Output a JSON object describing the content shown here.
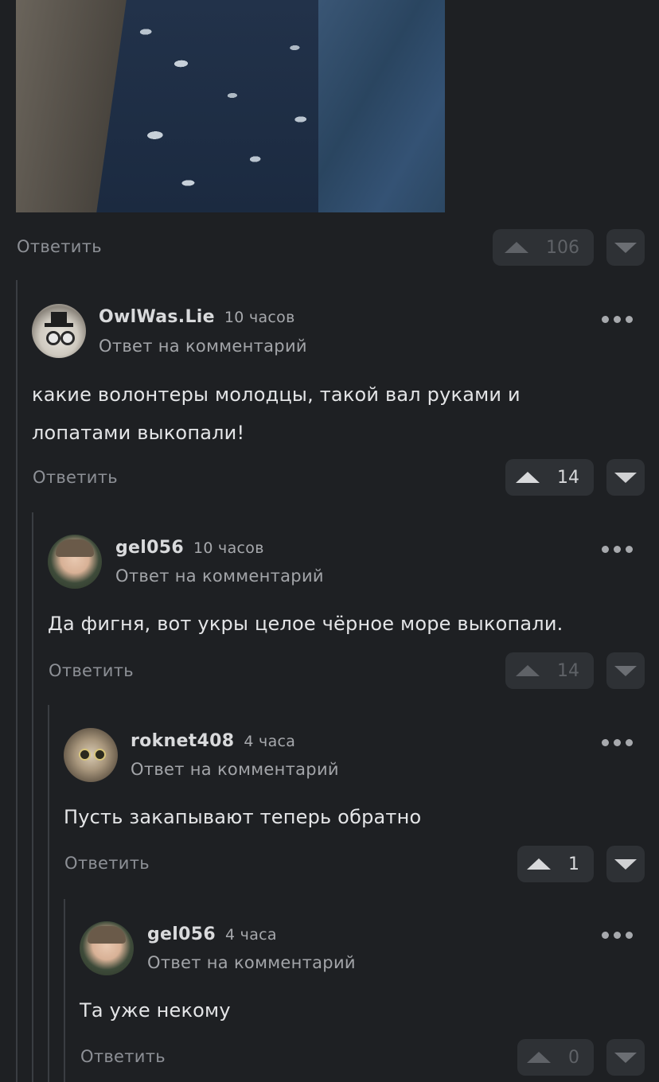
{
  "top": {
    "reply_label": "Ответить",
    "votes": "106"
  },
  "comments": [
    {
      "username": "OwlWas.Lie",
      "time": "10 часов",
      "subtitle": "Ответ на комментарий",
      "text_line1": "какие волонтеры молодцы, такой вал руками и",
      "text_line2": "лопатами выкопали!",
      "reply_label": "Ответить",
      "votes": "14",
      "avatar": "owl-avatar"
    },
    {
      "username": "gel056",
      "time": "10 часов",
      "subtitle": "Ответ на комментарий",
      "text_line1": "Да фигня, вот укры целое чёрное море выкопали.",
      "reply_label": "Ответить",
      "votes": "14",
      "avatar": "kid-avatar"
    },
    {
      "username": "roknet408",
      "time": "4 часа",
      "subtitle": "Ответ на комментарий",
      "text_line1": "Пусть закапывают теперь обратно",
      "reply_label": "Ответить",
      "votes": "1",
      "avatar": "cat-avatar"
    },
    {
      "username": "gel056",
      "time": "4 часа",
      "subtitle": "Ответ на комментарий",
      "text_line1": "Та уже некому",
      "reply_label": "Ответить",
      "votes": "0",
      "avatar": "kid-avatar"
    }
  ]
}
